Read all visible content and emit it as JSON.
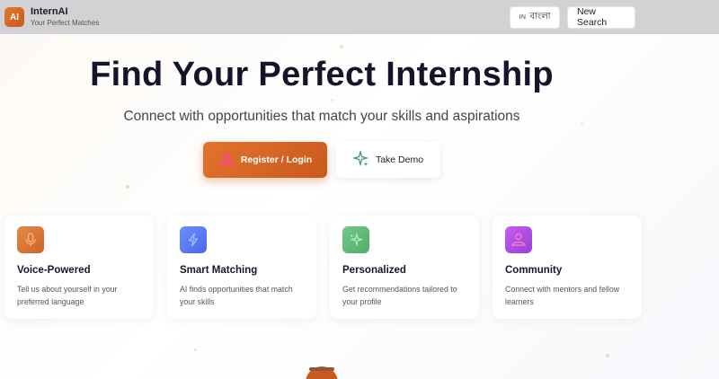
{
  "header": {
    "logo_text": "AI",
    "brand_name": "InternAI",
    "tagline": "Your Perfect Matches",
    "lang_code": "IN",
    "lang_label": "বাংলা",
    "new_search_label": "New Search"
  },
  "hero": {
    "title": "Find Your Perfect Internship",
    "subtitle": "Connect with opportunities that match your skills and aspirations",
    "primary_cta": "Register / Login",
    "secondary_cta": "Take Demo"
  },
  "features": [
    {
      "icon": "microphone-icon",
      "title": "Voice-Powered",
      "description": "Tell us about yourself in your preferred language",
      "color": "#e07a35"
    },
    {
      "icon": "lightning-icon",
      "title": "Smart Matching",
      "description": "AI finds opportunities that match your skills",
      "color": "#5b7cf5"
    },
    {
      "icon": "sparkles-icon",
      "title": "Personalized",
      "description": "Get recommendations tailored to your profile",
      "color": "#5fbf78"
    },
    {
      "icon": "people-icon",
      "title": "Community",
      "description": "Connect with mentors and fellow learners",
      "color": "#b34fe0"
    }
  ],
  "colors": {
    "accent": "#d9662a",
    "header_bg": "#d2d2d5"
  }
}
